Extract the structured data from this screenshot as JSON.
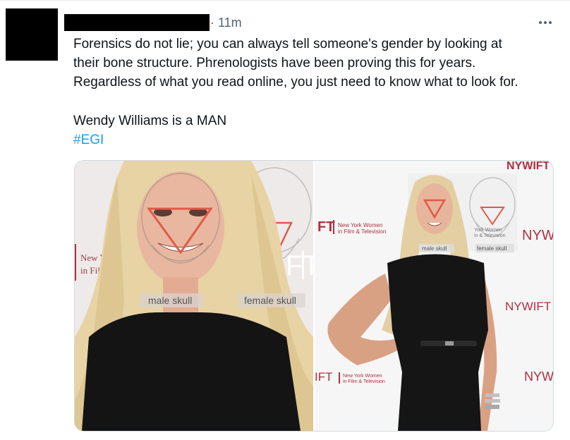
{
  "tweet": {
    "time": "11m",
    "lines": [
      "Forensics do not lie; you can always tell someone's gender by looking at",
      "their bone structure. Phrenologists have been proving this for years.",
      "Regardless of what you read online, you just need to know what to look for."
    ],
    "second_line": "Wendy Williams is a MAN",
    "hashtag": "#EGI"
  },
  "images": {
    "left": {
      "backdrop_left": "New Yo",
      "backdrop_left2": "in Film",
      "backdrop_mid": "WIFT",
      "male_label": "male skull",
      "female_label": "female skull"
    },
    "right": {
      "brand_top": "NYWIFT",
      "org_short": "FT",
      "org_name": "New York Women",
      "org_sub": "in Film & Television",
      "brand_right": "NYW",
      "brand_mid": "NYWIFT",
      "bottom_org_short": "IFT",
      "bottom_org_name": "New York Women",
      "bottom_org_sub": "in Film & Television",
      "brand_bottom_right": "NYW",
      "male_label": "male skull",
      "female_label": "female skull",
      "overlay_org": "York Women",
      "overlay_sub": "in & Television"
    }
  },
  "colors": {
    "link": "#1d9bf0",
    "muted": "#536471",
    "overlay_red": "#e05a4a"
  }
}
